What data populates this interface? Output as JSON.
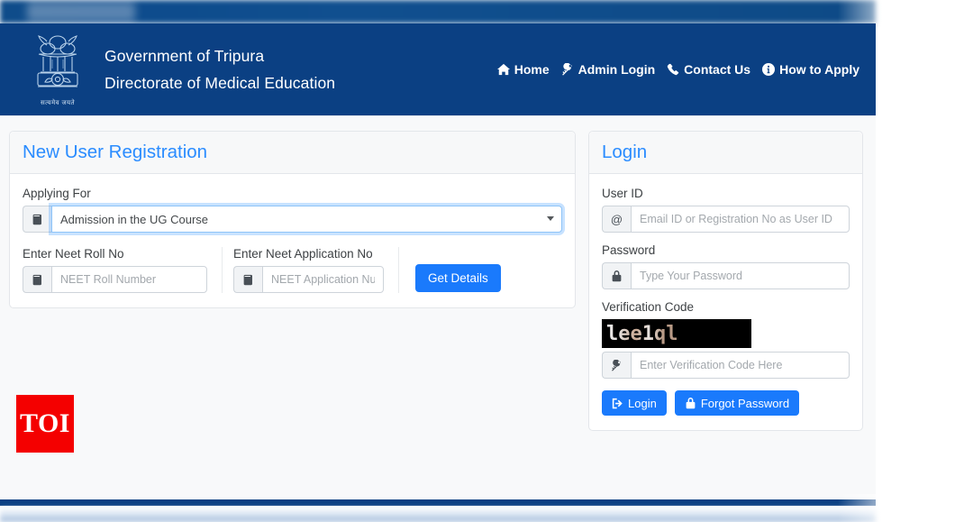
{
  "header": {
    "emblem_icon": "india-state-emblem-icon",
    "emblem_motto": "सत्यमेव जयते",
    "line1": "Government of Tripura",
    "line2": "Directorate of Medical Education",
    "bg_color": "#0b4083",
    "nav": [
      {
        "label": "Home",
        "icon": "home-icon"
      },
      {
        "label": "Admin Login",
        "icon": "key-icon"
      },
      {
        "label": "Contact Us",
        "icon": "phone-icon"
      },
      {
        "label": "How to Apply",
        "icon": "info-circle-icon"
      }
    ]
  },
  "registration": {
    "title": "New User Registration",
    "title_color": "#2a8cff",
    "applying_for": {
      "label": "Applying For",
      "icon": "book-icon",
      "selected": "Admission in the UG Course",
      "options": [
        "Admission in the UG Course"
      ]
    },
    "neet_roll": {
      "label": "Enter Neet Roll No",
      "icon": "book-icon",
      "value": "",
      "placeholder": "NEET Roll Number"
    },
    "neet_application": {
      "label": "Enter Neet Application No",
      "icon": "book-icon",
      "value": "",
      "placeholder": "NEET Application Number"
    },
    "get_details_label": "Get Details"
  },
  "login": {
    "title": "Login",
    "title_color": "#2a8cff",
    "user_id": {
      "label": "User ID",
      "icon": "at-icon",
      "value": "",
      "placeholder": "Email ID or Registration No as User ID"
    },
    "password": {
      "label": "Password",
      "icon": "lock-icon",
      "value": "",
      "placeholder": "Type Your Password"
    },
    "verification": {
      "label": "Verification Code",
      "captcha_text": "lee1ql",
      "captcha_bg": "#000000",
      "icon": "key-icon",
      "value": "",
      "placeholder": "Enter Verification Code Here"
    },
    "login_button": {
      "label": "Login",
      "icon": "sign-in-icon"
    },
    "forgot_button": {
      "label": "Forgot Password",
      "icon": "lock-icon"
    },
    "button_color": "#1a7afc"
  },
  "watermark": {
    "text": "TOI",
    "bg_color": "#f40000"
  }
}
